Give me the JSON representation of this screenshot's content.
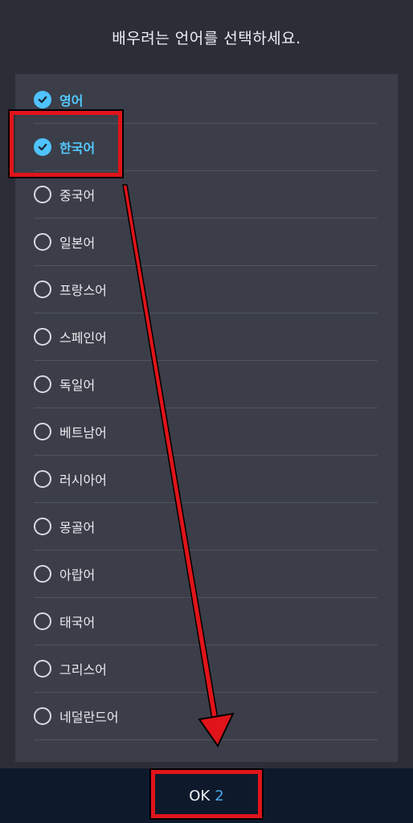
{
  "header": {
    "title": "배우려는 언어를 선택하세요."
  },
  "languages": [
    {
      "label": "영어",
      "checked": true
    },
    {
      "label": "한국어",
      "checked": true
    },
    {
      "label": "중국어",
      "checked": false
    },
    {
      "label": "일본어",
      "checked": false
    },
    {
      "label": "프랑스어",
      "checked": false
    },
    {
      "label": "스페인어",
      "checked": false
    },
    {
      "label": "독일어",
      "checked": false
    },
    {
      "label": "베트남어",
      "checked": false
    },
    {
      "label": "러시아어",
      "checked": false
    },
    {
      "label": "몽골어",
      "checked": false
    },
    {
      "label": "아랍어",
      "checked": false
    },
    {
      "label": "태국어",
      "checked": false
    },
    {
      "label": "그리스어",
      "checked": false
    },
    {
      "label": "네덜란드어",
      "checked": false
    }
  ],
  "footer": {
    "ok_label": "OK",
    "selected_count": "2"
  },
  "colors": {
    "accent": "#4fc3ff",
    "annotation": "#e0141a"
  }
}
